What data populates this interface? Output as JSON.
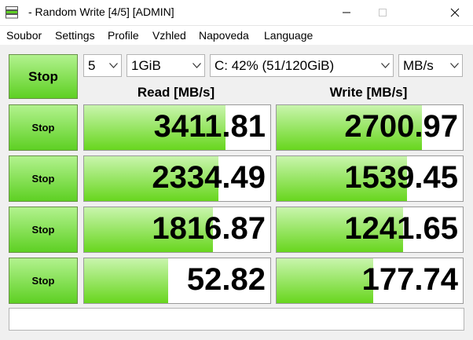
{
  "window": {
    "title": "- Random Write [4/5] [ADMIN]"
  },
  "menu": [
    "Soubor",
    "Settings",
    "Profile",
    "Vzhled",
    "Napoveda",
    "Language"
  ],
  "toolbar": {
    "main_button_label": "Stop",
    "count_value": "5",
    "size_value": "1GiB",
    "drive_value": "C: 42% (51/120GiB)",
    "unit_value": "MB/s"
  },
  "headers": {
    "read": "Read [MB/s]",
    "write": "Write [MB/s]"
  },
  "rows": [
    {
      "button_label": "Stop",
      "read": "3411.81",
      "read_level": 0.76,
      "write": "2700.97",
      "write_level": 0.78
    },
    {
      "button_label": "Stop",
      "read": "2334.49",
      "read_level": 0.72,
      "write": "1539.45",
      "write_level": 0.7
    },
    {
      "button_label": "Stop",
      "read": "1816.87",
      "read_level": 0.69,
      "write": "1241.65",
      "write_level": 0.68
    },
    {
      "button_label": "Stop",
      "read": "52.82",
      "read_level": 0.45,
      "write": "177.74",
      "write_level": 0.52
    }
  ],
  "status": {
    "text": ""
  },
  "colors": {
    "button_green_top": "#b2f28e",
    "button_green_bottom": "#5ed023",
    "bar_green_top": "#c9f5ad",
    "bar_green_bottom": "#68d61e"
  },
  "icons": {
    "app": "app-icon",
    "minimize": "minimize-icon",
    "maximize": "maximize-icon",
    "close": "close-icon"
  }
}
